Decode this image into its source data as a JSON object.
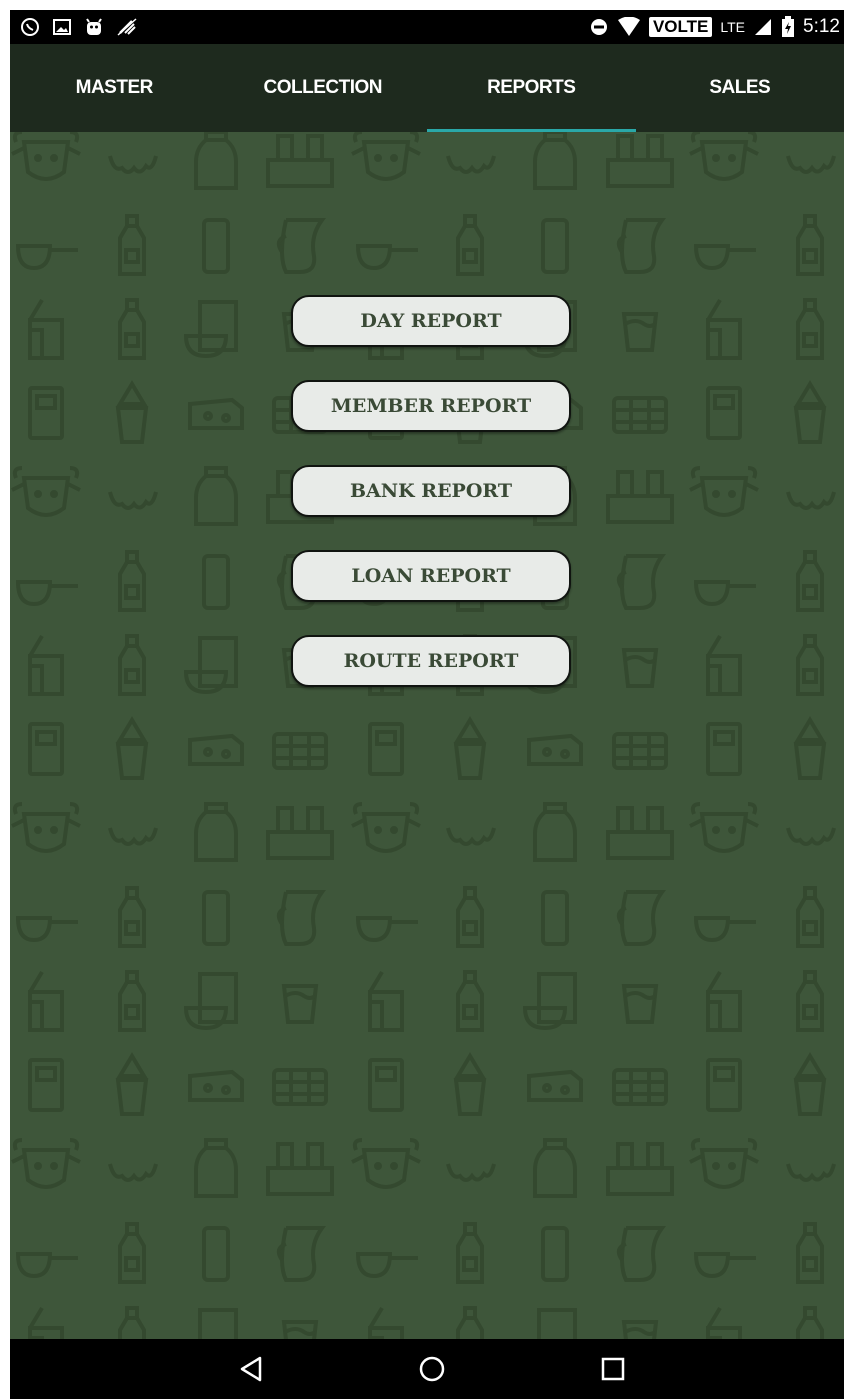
{
  "status_bar": {
    "left_icons": [
      "whatsapp-icon",
      "gallery-icon",
      "android-icon",
      "satellite-off-icon"
    ],
    "right_icons": [
      "do-not-disturb-icon",
      "wifi-icon"
    ],
    "volte_label": "VOLTE",
    "network_label": "LTE",
    "time": "5:12"
  },
  "tabs": [
    {
      "label": "MASTER",
      "active": false
    },
    {
      "label": "COLLECTION",
      "active": false
    },
    {
      "label": "REPORTS",
      "active": true
    },
    {
      "label": "SALES",
      "active": false
    }
  ],
  "reports": {
    "buttons": [
      {
        "label": "DAY REPORT"
      },
      {
        "label": "MEMBER REPORT"
      },
      {
        "label": "BANK REPORT"
      },
      {
        "label": "LOAN REPORT"
      },
      {
        "label": "ROUTE REPORT"
      }
    ]
  },
  "background": {
    "pattern_icons": [
      "cow-icon",
      "udder-icon",
      "milk-jar-icon",
      "milk-crate-icon",
      "milk-pan-icon",
      "milk-bottle-icon",
      "glass-icon",
      "jug-icon",
      "carton-icon",
      "bowl-icon",
      "cup-icon",
      "tray-icon",
      "cheese-icon",
      "shaker-icon"
    ],
    "colors": {
      "base": "#3e563a",
      "icon": "#34492f"
    }
  },
  "colors": {
    "tab_bar": "#1e2a1e",
    "tab_indicator": "#2aa8a8",
    "button_bg": "#e8ebe8",
    "button_text": "#3a4a36"
  },
  "nav_bar": {
    "icons": [
      "back-icon",
      "home-icon",
      "recents-icon"
    ]
  }
}
